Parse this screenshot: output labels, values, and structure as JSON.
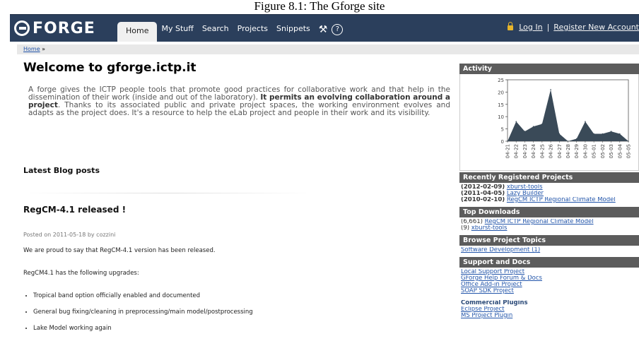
{
  "figure_caption": "Figure 8.1: The Gforge site",
  "header": {
    "logo_text": "FORGE",
    "tabs": [
      {
        "label": "Home",
        "active": true
      },
      {
        "label": "My Stuff"
      },
      {
        "label": "Search"
      },
      {
        "label": "Projects"
      },
      {
        "label": "Snippets"
      }
    ],
    "login_label": "Log In",
    "separator": "|",
    "register_label": "Register New Account"
  },
  "breadcrumb": {
    "home": "Home",
    "sep": "»"
  },
  "main": {
    "title": "Welcome to gforge.ictp.it",
    "intro_1": "A forge gives the ICTP people tools that promote good practices for collaborative work and that help in the dissemination of their work (inside and out of the laboratory). ",
    "intro_bold": "It permits an evolving collaboration around a project",
    "intro_2": ". Thanks to its associated public and private project spaces, the working environment evolves and adapts as the project does. It's a resource to help the eLab project and people in their work and its visibility.",
    "latest_heading": "Latest Blog posts",
    "post": {
      "title": "RegCM-4.1 released !",
      "meta": "Posted on 2011-05-18 by cozzini",
      "para1": "We are proud to say that RegCM-4.1 version has been released.",
      "para2": "RegCM4.1 has the following upgrades:",
      "items": [
        "Tropical band option officially enabled and documented",
        "General bug fixing/cleaning in preprocessing/main model/postprocessing",
        "Lake Model working again"
      ]
    }
  },
  "sidebar": {
    "activity_title": "Activity",
    "recent_title": "Recently Registered Projects",
    "recent": [
      {
        "date": "(2012-02-09)",
        "name": "xburst-tools"
      },
      {
        "date": "(2011-04-05)",
        "name": "Lazy Builder"
      },
      {
        "date": "(2010-02-10)",
        "name": "RegCM ICTP Regional Climate Model"
      }
    ],
    "downloads_title": "Top Downloads",
    "downloads": [
      {
        "count": "(6,661)",
        "name": "RegCM ICTP Regional Climate Model"
      },
      {
        "count": "(9)",
        "name": "xburst-tools"
      }
    ],
    "topics_title": "Browse Project Topics",
    "topic": "Software Development (1)",
    "support_title": "Support and Docs",
    "support_links": [
      "Local Support Project",
      "GForge Help Forum & Docs",
      "Office Add-in Project",
      "SOAP SDK Project"
    ],
    "commercial_title": "Commercial Plugins",
    "commercial_links": [
      "Eclipse Project",
      "MS Project Plugin"
    ]
  },
  "chart_data": {
    "type": "area",
    "title": "",
    "color": "#3a4a58",
    "ylim": [
      0,
      25
    ],
    "yticks": [
      0,
      5,
      10,
      15,
      20,
      25
    ],
    "x": [
      "04-21",
      "04-22",
      "04-23",
      "04-24",
      "04-25",
      "04-26",
      "04-27",
      "04-28",
      "04-29",
      "04-30",
      "05-01",
      "05-02",
      "05-03",
      "05-04",
      "05-05"
    ],
    "values": [
      0,
      8,
      4,
      6,
      7,
      21,
      3,
      0,
      1,
      8,
      3,
      3,
      4,
      3,
      0
    ]
  }
}
